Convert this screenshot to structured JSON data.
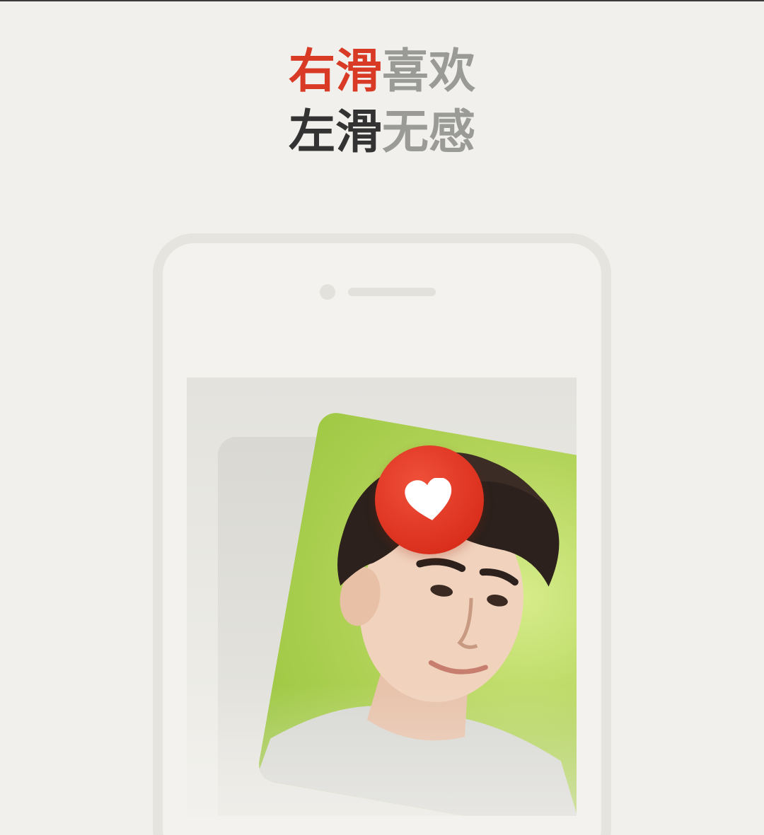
{
  "headline": {
    "line1_accent": "右滑",
    "line1_rest": "喜欢",
    "line2_accent": "左滑",
    "line2_rest": "无感"
  },
  "colors": {
    "accent": "#d83a26",
    "dark_text": "#333333",
    "muted_text": "#9a9a96",
    "background": "#f2f0ec",
    "card_green": "#a8cf4a"
  },
  "icons": {
    "like": "heart-icon"
  }
}
